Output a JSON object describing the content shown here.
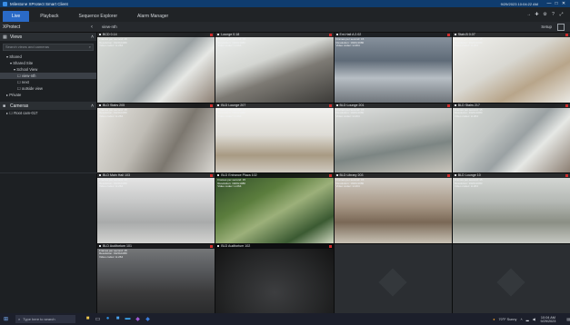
{
  "window": {
    "title": "Milestone XProtect Smart Client",
    "clock": "9/29/2023 10:04:22 AM",
    "buttons": [
      "—",
      "□",
      "✕"
    ]
  },
  "tabs": [
    {
      "label": "Live",
      "active": true
    },
    {
      "label": "Playback",
      "active": false
    },
    {
      "label": "Sequence Explorer",
      "active": false
    },
    {
      "label": "Alarm Manager",
      "active": false
    }
  ],
  "toolbar_icons": [
    "arrow-icon",
    "pin-icon",
    "gear-icon",
    "help-icon",
    "expand-icon"
  ],
  "subbar": {
    "app_name": "XProtect",
    "view_name": "view-nth",
    "setup_label": "Setup"
  },
  "sidebar": {
    "views_title": "Views",
    "search_placeholder": "Search views and cameras",
    "tree": [
      {
        "label": "▾ Shared",
        "indent": 1,
        "selected": false
      },
      {
        "label": "▾ Shared Site",
        "indent": 2,
        "selected": false
      },
      {
        "label": "▾ School View",
        "indent": 3,
        "selected": false
      },
      {
        "label": "☐ view-nth",
        "indent": 4,
        "selected": true
      },
      {
        "label": "☐ next",
        "indent": 4,
        "selected": false
      },
      {
        "label": "☐ outside view",
        "indent": 4,
        "selected": false
      },
      {
        "label": "▸ Private",
        "indent": 1,
        "selected": false
      }
    ],
    "cameras_title": "Cameras",
    "camera_tree": [
      {
        "label": "▸ ☐ Root cam-017",
        "indent": 1
      }
    ]
  },
  "cameras": [
    {
      "name": "BCD 0.14",
      "scene": "stairwell-white",
      "stats": [
        "Frames per second: 15",
        "Resolution: 1920x1080",
        "Video codec: H.264"
      ],
      "recording": true
    },
    {
      "name": "Lounge 0.18",
      "scene": "stairs-down",
      "stats": [
        "Frames per second: 15",
        "Resolution: 1920x1080",
        "Video codec: H.264"
      ],
      "recording": true
    },
    {
      "name": "Ent-Hall A 2.02",
      "scene": "lobby-tiles",
      "stats": [
        "Frames per second: 15",
        "Resolution: 1920x1080",
        "Video codec: H.264"
      ],
      "recording": true
    },
    {
      "name": "Stair-B 0.07",
      "scene": "stairwell-bright",
      "stats": [
        "Frames per second: 15",
        "Resolution: 1920x1080",
        "Video codec: H.264"
      ],
      "recording": true
    },
    {
      "name": "BLD Stairs 205",
      "scene": "stairs-rail",
      "stats": [
        "Frames per second: 15",
        "Resolution: 1920x1080",
        "Video codec: H.264"
      ],
      "recording": true
    },
    {
      "name": "BLD Lounge 207",
      "scene": "corridor-window",
      "stats": [
        "Frames per second: 15",
        "Resolution: 1920x1080",
        "Video codec: H.264"
      ],
      "recording": true
    },
    {
      "name": "BLD Lounge 201",
      "scene": "lounge-seats",
      "stats": [
        "Frames per second: 15",
        "Resolution: 1920x1080",
        "Video codec: H.264"
      ],
      "recording": true
    },
    {
      "name": "BLD Stairs 217",
      "scene": "stairwell-white",
      "stats": [
        "Frames per second: 15",
        "Resolution: 1920x1080",
        "Video codec: H.264"
      ],
      "recording": true
    },
    {
      "name": "BLD Main Hall 103",
      "scene": "lecture-hall",
      "stats": [
        "Frames per second: 15",
        "Resolution: 1920x1080",
        "Video codec: H.264"
      ],
      "recording": true
    },
    {
      "name": "BLD Entrance Plaza 102",
      "scene": "plants",
      "stats": [
        "Frames per second: 15",
        "Resolution: 1920x1080",
        "Video codec: H.264"
      ],
      "recording": true
    },
    {
      "name": "BLD Library 203",
      "scene": "cafeteria",
      "stats": [
        "Frames per second: 15",
        "Resolution: 1920x1080",
        "Video codec: H.264"
      ],
      "recording": true
    },
    {
      "name": "BLD Lounge 10",
      "scene": "library",
      "stats": [
        "Frames per second: 15",
        "Resolution: 1920x1080",
        "Video codec: H.264"
      ],
      "recording": true
    },
    {
      "name": "BLD Auditorium 101",
      "scene": "auditorium",
      "stats": [
        "Frames per second: 15",
        "Resolution: 1920x1080",
        "Video codec: H.264"
      ],
      "recording": true
    },
    {
      "name": "BLD Auditorium 102",
      "scene": "auditorium-dark",
      "stats": [],
      "recording": true
    },
    {
      "name": "",
      "scene": "empty",
      "stats": [],
      "recording": false
    },
    {
      "name": "",
      "scene": "empty",
      "stats": [],
      "recording": false
    }
  ],
  "taskbar": {
    "search_placeholder": "Type here to search",
    "apps": [
      "file-explorer-icon",
      "task-view-icon",
      "edge-icon",
      "store-icon",
      "mail-icon",
      "settings-icon",
      "app-icon"
    ],
    "tray": {
      "weather": "70°F Sunny",
      "time": "10:04 AM",
      "date": "9/29/2023"
    }
  }
}
